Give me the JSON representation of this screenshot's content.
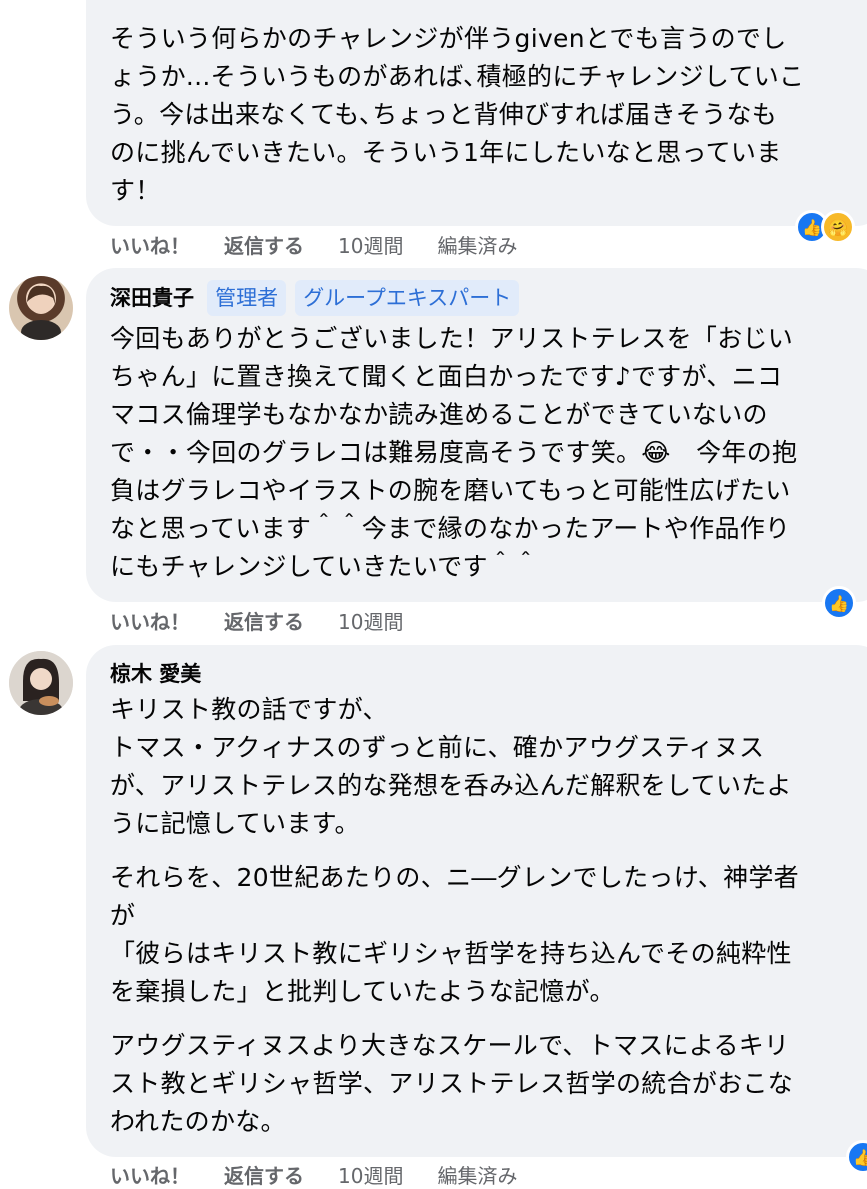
{
  "comments": [
    {
      "body": "そういう何らかのチャレンジが伴うgivenとでも言うのでし\nょうか...そういうものがあれば､積極的にチャレンジしていこ\nう。今は出来なくても､ちょっと背伸びすれば届きそうなも\nのに挑んでいきたい。そういう1年にしたいなと思っていま\nす！",
      "actions": {
        "like": "いいね！",
        "reply": "返信する",
        "time": "10週間",
        "edited": "編集済み"
      }
    },
    {
      "author": "深田貴子",
      "badges": [
        "管理者",
        "グループエキスパート"
      ],
      "body": "今回もありがとうございました！アリストテレスを「おじい\nちゃん」に置き換えて聞くと面白かったです♪ですが、ニコ\nマコス倫理学もなかなか読み進めることができていないの\nで・・今回のグラレコは難易度高そうです笑。😂　今年の抱\n負はグラレコやイラストの腕を磨いてもっと可能性広げたい\nなと思っています＾＾今まで縁のなかったアートや作品作り\nにもチャレンジしていきたいです＾＾",
      "actions": {
        "like": "いいね！",
        "reply": "返信する",
        "time": "10週間"
      }
    },
    {
      "author": "椋木 愛美",
      "paragraphs": [
        "キリスト教の話ですが、\nトマス・アクィナスのずっと前に、確かアウグスティヌス\nが、アリストテレス的な発想を呑み込んだ解釈をしていたよ\nうに記憶しています。",
        "それらを、20世紀あたりの、ニ―グレンでしたっけ、神学者\nが\n「彼らはキリスト教にギリシャ哲学を持ち込んでその純粋性\nを棄損した」と批判していたような記憶が。",
        "アウグスティヌスより大きなスケールで、トマスによるキリ\nスト教とギリシャ哲学、アリストテレス哲学の統合がおこな\nわれたのかな。"
      ],
      "actions": {
        "like": "いいね！",
        "reply": "返信する",
        "time": "10週間",
        "edited": "編集済み"
      }
    }
  ]
}
